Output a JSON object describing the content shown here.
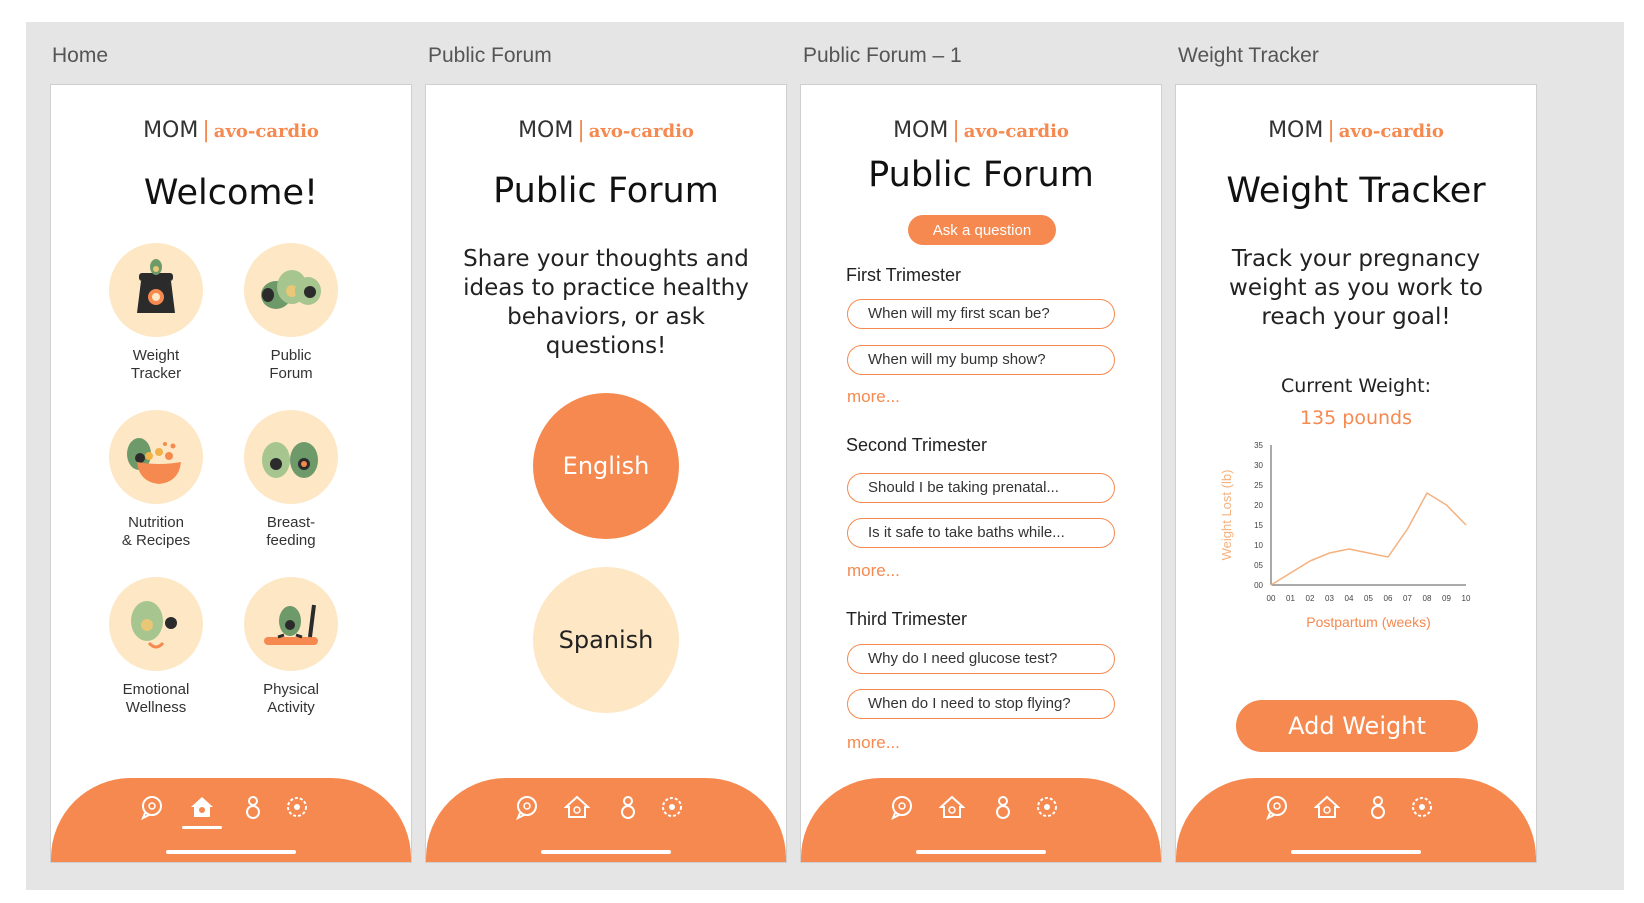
{
  "frames": [
    {
      "title": "Home"
    },
    {
      "title": "Public Forum"
    },
    {
      "title": "Public Forum – 1"
    },
    {
      "title": "Weight Tracker"
    }
  ],
  "brand": {
    "name": "MOM",
    "separator": "|",
    "app": "avo-cardio"
  },
  "home": {
    "title": "Welcome!",
    "tiles": [
      {
        "label": "Weight\nTracker",
        "icon": "scale-icon"
      },
      {
        "label": "Public\nForum",
        "icon": "avocados-icon"
      },
      {
        "label": "Nutrition\n& Recipes",
        "icon": "food-bowl-icon"
      },
      {
        "label": "Breast-\nfeeding",
        "icon": "avocado-pair-icon"
      },
      {
        "label": "Emotional\nWellness",
        "icon": "smiling-avocado-icon"
      },
      {
        "label": "Physical\nActivity",
        "icon": "treadmill-icon"
      }
    ]
  },
  "forum": {
    "title": "Public Forum",
    "blurb": "Share your thoughts and ideas to practice healthy behaviors, or ask questions!",
    "english": "English",
    "spanish": "Spanish"
  },
  "forum1": {
    "title": "Public Forum",
    "ask": "Ask a question",
    "sections": [
      {
        "heading": "First Trimester",
        "questions": [
          "When will my first scan be?",
          "When will my bump show?"
        ],
        "more": "more..."
      },
      {
        "heading": "Second Trimester",
        "questions": [
          "Should I be taking prenatal...",
          "Is it safe to take baths while..."
        ],
        "more": "more..."
      },
      {
        "heading": "Third Trimester",
        "questions": [
          "Why do I need glucose test?",
          "When do I need to stop flying?"
        ],
        "more": "more..."
      }
    ]
  },
  "tracker": {
    "title": "Weight Tracker",
    "blurb": "Track your pregnancy weight as you work to reach your goal!",
    "current_label": "Current Weight:",
    "current_value": "135 pounds",
    "add": "Add Weight"
  },
  "nav": {
    "icons": [
      "chat-icon",
      "home-icon",
      "profile-icon",
      "settings-icon"
    ],
    "active_on_home": "home-icon"
  },
  "colors": {
    "accent": "#f5894f",
    "cream": "#fde7c4",
    "board": "#e5e5e5"
  },
  "chart_data": {
    "type": "line",
    "xlabel": "Postpartum (weeks)",
    "ylabel": "Weight Lost (lb)",
    "x_ticks": [
      "00",
      "01",
      "02",
      "03",
      "04",
      "05",
      "06",
      "07",
      "08",
      "09",
      "10"
    ],
    "y_ticks": [
      "00",
      "05",
      "10",
      "15",
      "20",
      "25",
      "30",
      "35"
    ],
    "xlim": [
      0,
      10
    ],
    "ylim": [
      0,
      35
    ],
    "x": [
      0,
      1,
      2,
      3,
      4,
      5,
      6,
      7,
      8,
      9,
      10
    ],
    "values": [
      0,
      3,
      6,
      8,
      9,
      8,
      7,
      14,
      23,
      20,
      15
    ]
  }
}
